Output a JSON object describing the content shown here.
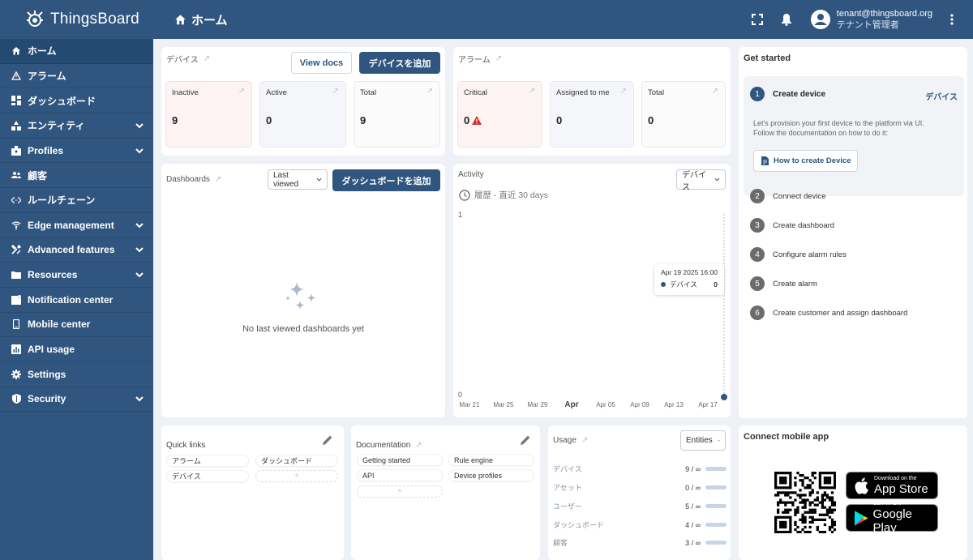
{
  "app": {
    "name": "ThingsBoard"
  },
  "header": {
    "breadcrumb": "ホーム",
    "user_email": "tenant@thingsboard.org",
    "user_role": "テナント管理者"
  },
  "sidebar": {
    "items": [
      {
        "label": "ホーム",
        "icon": "home-icon"
      },
      {
        "label": "アラーム",
        "icon": "warning-icon"
      },
      {
        "label": "ダッシュボード",
        "icon": "dashboard-icon"
      },
      {
        "label": "エンティティ",
        "icon": "entity-icon"
      },
      {
        "label": "Profiles",
        "icon": "badge-icon"
      },
      {
        "label": "顧客",
        "icon": "people-icon"
      },
      {
        "label": "ルールチェーン",
        "icon": "code-icon"
      },
      {
        "label": "Edge management",
        "icon": "router-icon"
      },
      {
        "label": "Advanced features",
        "icon": "tools-icon"
      },
      {
        "label": "Resources",
        "icon": "folder-icon"
      },
      {
        "label": "Notification center",
        "icon": "notification-icon"
      },
      {
        "label": "Mobile center",
        "icon": "phone-icon"
      },
      {
        "label": "API usage",
        "icon": "chart-icon"
      },
      {
        "label": "Settings",
        "icon": "gear-icon"
      },
      {
        "label": "Security",
        "icon": "shield-icon"
      }
    ]
  },
  "devices": {
    "title": "デバイス",
    "view_docs": "View docs",
    "add": "デバイスを追加",
    "tiles": [
      {
        "label": "Inactive",
        "value": "9"
      },
      {
        "label": "Active",
        "value": "0"
      },
      {
        "label": "Total",
        "value": "9"
      }
    ]
  },
  "alarms": {
    "title": "アラーム",
    "tiles": [
      {
        "label": "Critical",
        "value": "0"
      },
      {
        "label": "Assigned to me",
        "value": "0"
      },
      {
        "label": "Total",
        "value": "0"
      }
    ]
  },
  "dashboards": {
    "title": "Dashboards",
    "filter": "Last viewed",
    "add": "ダッシュボードを追加",
    "empty": "No last viewed dashboards yet"
  },
  "activity": {
    "title": "Activity",
    "filter": "デバイス",
    "period": "履歴 - 直近 30 days",
    "tooltip_time": "Apr 19 2025 16:00",
    "tooltip_series": "デバイス",
    "tooltip_value": "0",
    "y_top": "1",
    "y_bottom": "0"
  },
  "chart_data": {
    "type": "line",
    "x": [
      "Mar 21",
      "Mar 25",
      "Mar 29",
      "Apr",
      "Apr 05",
      "Apr 09",
      "Apr 13",
      "Apr 17"
    ],
    "series": [
      {
        "name": "デバイス",
        "values": [
          0,
          0,
          0,
          0,
          0,
          0,
          0,
          0
        ]
      }
    ],
    "ylim": [
      0,
      1
    ],
    "color": "#305680"
  },
  "get_started": {
    "title": "Get started",
    "steps": [
      {
        "num": "1",
        "label": "Create device"
      },
      {
        "num": "2",
        "label": "Connect device"
      },
      {
        "num": "3",
        "label": "Create dashboard"
      },
      {
        "num": "4",
        "label": "Configure alarm rules"
      },
      {
        "num": "5",
        "label": "Create alarm"
      },
      {
        "num": "6",
        "label": "Create customer and assign dashboard"
      }
    ],
    "step1_link": "デバイス",
    "step1_desc_1": "Let's provision your first device to the platform via UI.",
    "step1_desc_2": "Follow the documentation on how to do it:",
    "step1_button": "How to create Device"
  },
  "quick_links": {
    "title": "Quick links",
    "items": [
      "アラーム",
      "ダッシュボード",
      "デバイス"
    ],
    "add": "+"
  },
  "documentation": {
    "title": "Documentation",
    "items": [
      "Getting started",
      "Rule engine",
      "API",
      "Device profiles"
    ],
    "add": "+"
  },
  "usage": {
    "title": "Usage",
    "filter": "Entities",
    "rows": [
      {
        "label": "デバイス",
        "value": "9 / ∞"
      },
      {
        "label": "アセット",
        "value": "0 / ∞"
      },
      {
        "label": "ユーザー",
        "value": "5 / ∞"
      },
      {
        "label": "ダッシュボード",
        "value": "4 / ∞"
      },
      {
        "label": "顧客",
        "value": "3 / ∞"
      }
    ]
  },
  "mobile": {
    "title": "Connect mobile app",
    "appstore_small": "Download on the",
    "appstore_big": "App Store",
    "gplay_small": "GET IT ON",
    "gplay_big": "Google Play"
  },
  "colors": {
    "primary": "#305680",
    "critical": "#d32f2f",
    "background": "#eef1f5"
  }
}
